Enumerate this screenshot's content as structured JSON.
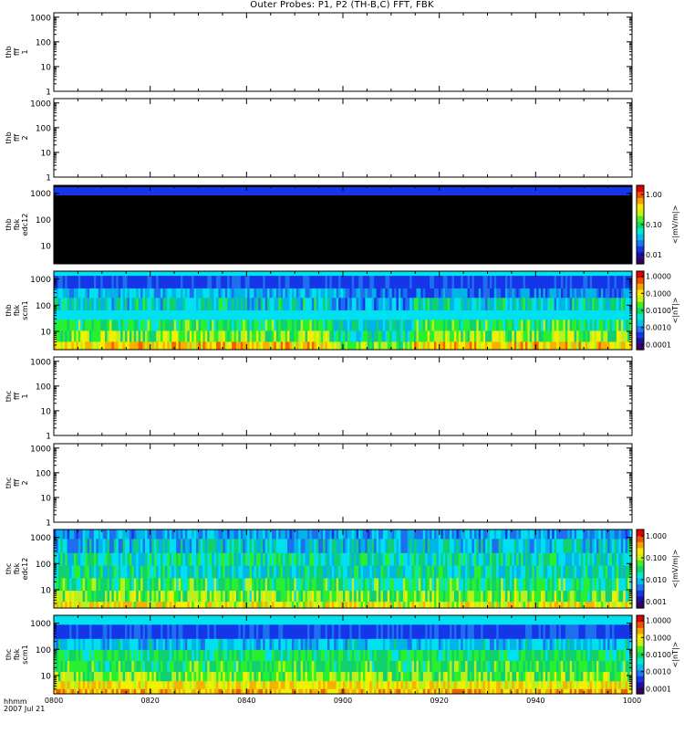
{
  "title": "Outer Probes: P1, P2 (TH-B,C) FFT, FBK",
  "footer": {
    "line1": "hhmm",
    "line2": "2007 Jul 21"
  },
  "chart_data": {
    "type": "heatmap",
    "x_ticks": [
      "0800",
      "0820",
      "0840",
      "0900",
      "0920",
      "0940",
      "1000"
    ],
    "y_scale": "log",
    "panels": [
      {
        "label": [
          "thb",
          "fff",
          "1"
        ],
        "yticks": [
          "1000",
          "100",
          "10",
          "1"
        ],
        "ylim": [
          1,
          1500
        ],
        "fill": "empty"
      },
      {
        "label": [
          "thb",
          "fff",
          "2"
        ],
        "yticks": [
          "1000",
          "100",
          "10",
          "1"
        ],
        "ylim": [
          1,
          1500
        ],
        "fill": "empty"
      },
      {
        "label": [
          "thb",
          "fbk",
          "edc12"
        ],
        "yticks": [
          "1000",
          "100",
          "10"
        ],
        "ylim": [
          2,
          2000
        ],
        "fill": "black-blue",
        "colorbar": {
          "ticks": [
            "1.00",
            "0.10",
            "0.01"
          ],
          "unit": "<|mV/m|>",
          "range": [
            0.005,
            2
          ]
        }
      },
      {
        "label": [
          "thb",
          "fbk",
          "scm1"
        ],
        "yticks": [
          "1000",
          "100",
          "10"
        ],
        "ylim": [
          2,
          2000
        ],
        "fill": "spectro-b",
        "colorbar": {
          "ticks": [
            "1.0000",
            "0.1000",
            "0.0100",
            "0.0010",
            "0.0001"
          ],
          "unit": "<|nT|>",
          "range": [
            5e-05,
            2
          ]
        }
      },
      {
        "label": [
          "thc",
          "fff",
          "1"
        ],
        "yticks": [
          "1000",
          "100",
          "10",
          "1"
        ],
        "ylim": [
          1,
          1500
        ],
        "fill": "empty"
      },
      {
        "label": [
          "thc",
          "fff",
          "2"
        ],
        "yticks": [
          "1000",
          "100",
          "10",
          "1"
        ],
        "ylim": [
          1,
          1500
        ],
        "fill": "empty"
      },
      {
        "label": [
          "thc",
          "fbk",
          "edc12"
        ],
        "yticks": [
          "1000",
          "100",
          "10"
        ],
        "ylim": [
          2,
          2000
        ],
        "fill": "spectro-c-edc",
        "colorbar": {
          "ticks": [
            "1.000",
            "0.100",
            "0.010",
            "0.001"
          ],
          "unit": "<|mV/m|>",
          "range": [
            0.0005,
            2
          ]
        }
      },
      {
        "label": [
          "thc",
          "fbk",
          "scm1"
        ],
        "yticks": [
          "1000",
          "100",
          "10"
        ],
        "ylim": [
          2,
          2000
        ],
        "fill": "spectro-c-scm",
        "colorbar": {
          "ticks": [
            "1.0000",
            "0.1000",
            "0.0100",
            "0.0010",
            "0.0001"
          ],
          "unit": "<|nT|>",
          "range": [
            5e-05,
            2
          ]
        }
      }
    ]
  }
}
